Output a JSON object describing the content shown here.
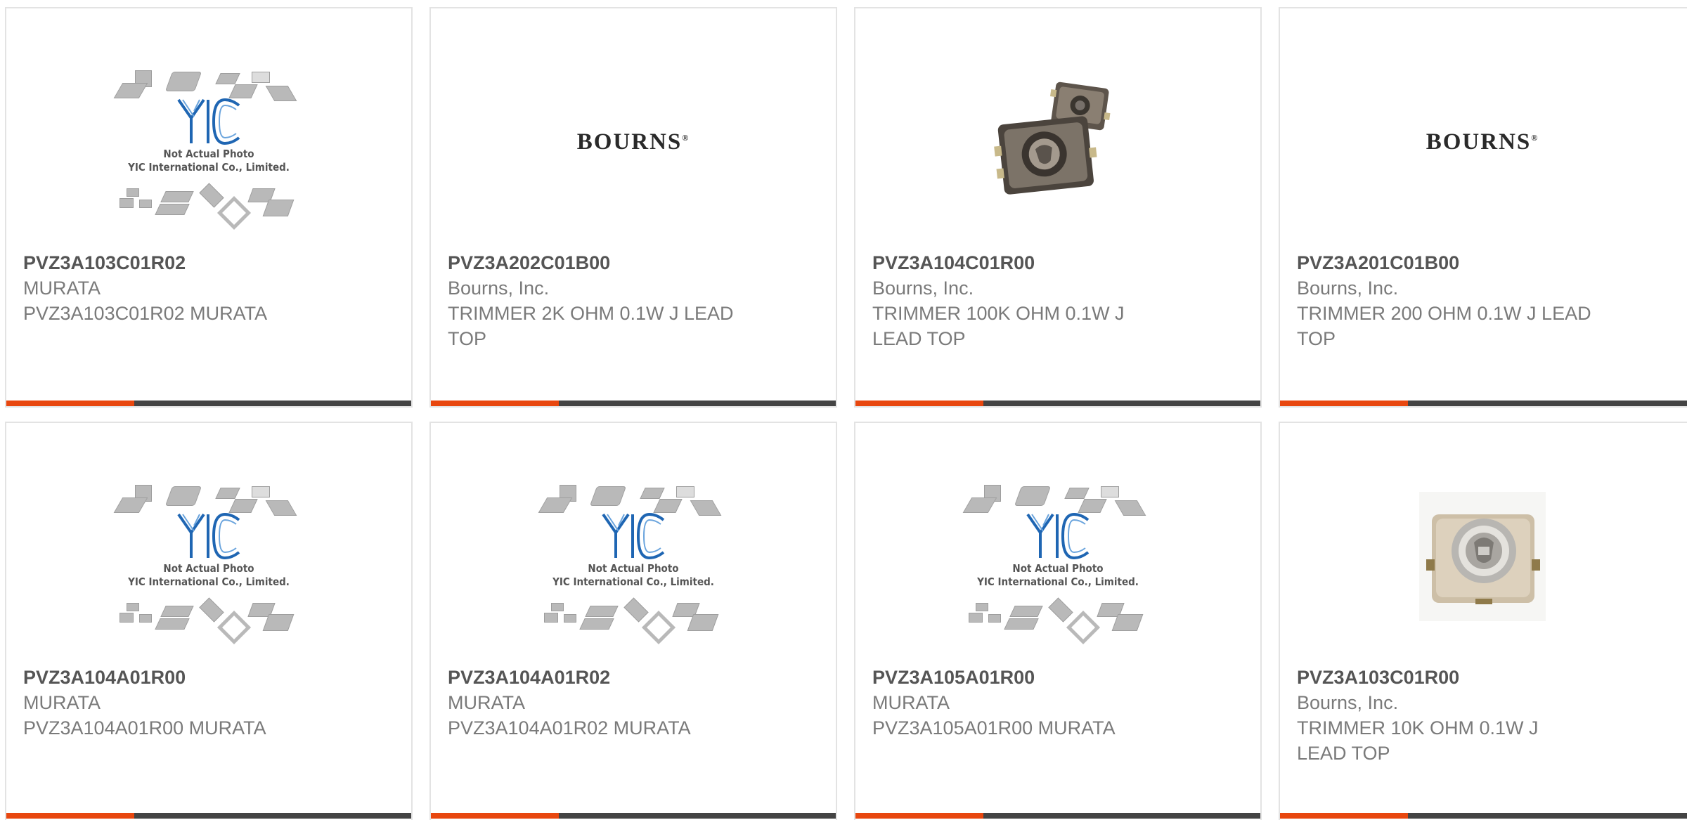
{
  "placeholder": {
    "line1": "Not Actual Photo",
    "line2": "YIC International Co., Limited."
  },
  "cards": [
    {
      "part": "PVZ3A103C01R02",
      "manufacturer": "MURATA",
      "description": "PVZ3A103C01R02 MURATA",
      "image": "placeholder"
    },
    {
      "part": "PVZ3A202C01B00",
      "manufacturer": "Bourns, Inc.",
      "description": "TRIMMER 2K OHM 0.1W J LEAD TOP",
      "image": "bourns-logo",
      "logo_text": "BOURNS"
    },
    {
      "part": "PVZ3A104C01R00",
      "manufacturer": "Bourns, Inc.",
      "description": "TRIMMER 100K OHM 0.1W J LEAD TOP",
      "image": "trimmer-photo-dark"
    },
    {
      "part": "PVZ3A201C01B00",
      "manufacturer": "Bourns, Inc.",
      "description": "TRIMMER 200 OHM 0.1W J LEAD TOP",
      "image": "bourns-logo",
      "logo_text": "BOURNS"
    },
    {
      "part": "PVZ3A104A01R00",
      "manufacturer": "MURATA",
      "description": "PVZ3A104A01R00 MURATA",
      "image": "placeholder"
    },
    {
      "part": "PVZ3A104A01R02",
      "manufacturer": "MURATA",
      "description": "PVZ3A104A01R02 MURATA",
      "image": "placeholder"
    },
    {
      "part": "PVZ3A105A01R00",
      "manufacturer": "MURATA",
      "description": "PVZ3A105A01R00 MURATA",
      "image": "placeholder"
    },
    {
      "part": "PVZ3A103C01R00",
      "manufacturer": "Bourns, Inc.",
      "description": "TRIMMER 10K OHM 0.1W J LEAD TOP",
      "image": "trimmer-photo-light"
    }
  ],
  "colors": {
    "accent": "#e8470f",
    "bar": "#444444",
    "border": "#e3e3e3",
    "yic_blue": "#1f66b3"
  }
}
